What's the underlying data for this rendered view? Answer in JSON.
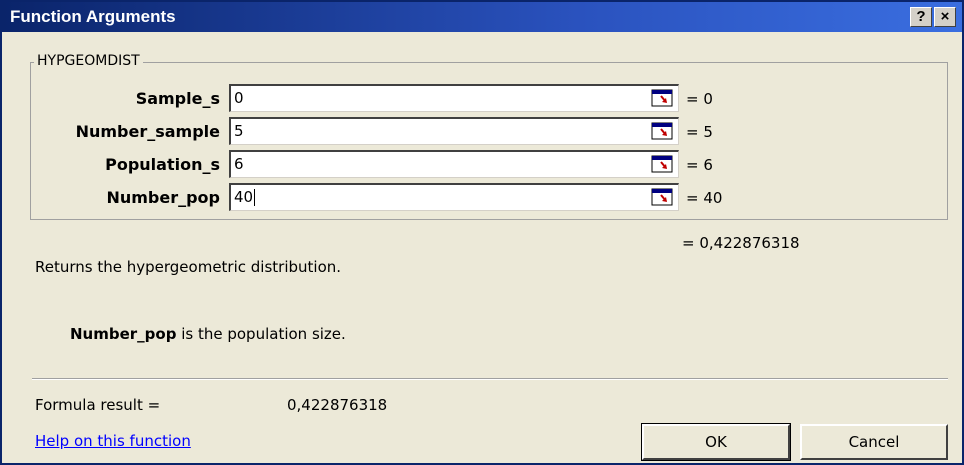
{
  "window": {
    "title": "Function Arguments",
    "help_button": "?",
    "close_button": "×"
  },
  "function_group": {
    "name": "HYPGEOMDIST",
    "args": [
      {
        "label": "Sample_s",
        "value": "0",
        "result": "= 0"
      },
      {
        "label": "Number_sample",
        "value": "5",
        "result": "= 5"
      },
      {
        "label": "Population_s",
        "value": "6",
        "result": "= 6"
      },
      {
        "label": "Number_pop",
        "value": "40",
        "result": "= 40"
      }
    ]
  },
  "formula_value": "= 0,422876318",
  "description": "Returns the hypergeometric distribution.",
  "arg_help": {
    "name": "Number_pop",
    "text": " is the population size."
  },
  "formula_result": {
    "label": "Formula result =",
    "value": "0,422876318"
  },
  "help_link": "Help on this function",
  "buttons": {
    "ok": "OK",
    "cancel": "Cancel"
  },
  "icons": {
    "ref_button": "collapse-dialog-icon"
  }
}
